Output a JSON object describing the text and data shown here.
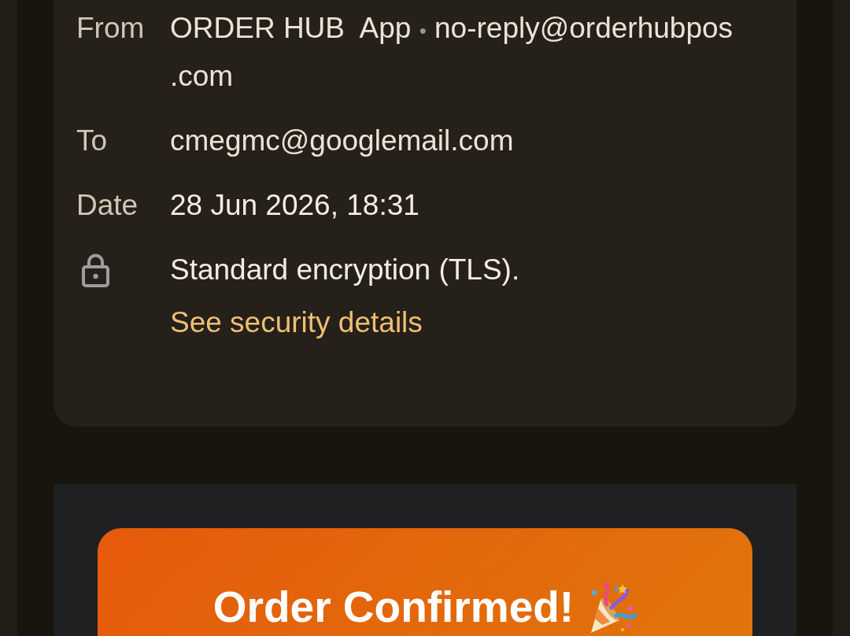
{
  "header": {
    "from": {
      "label": "From",
      "sender_name": "ORDER HUB  App",
      "separator": "•",
      "sender_email": "no-reply@orderhubpos.com"
    },
    "to": {
      "label": "To",
      "value": "cmegmc@googlemail.com"
    },
    "date": {
      "label": "Date",
      "value": "28 Jun 2026, 18:31"
    },
    "encryption": {
      "text": "Standard encryption (TLS).",
      "link": "See security details"
    }
  },
  "body": {
    "banner": {
      "title": "Order Confirmed!"
    }
  }
}
